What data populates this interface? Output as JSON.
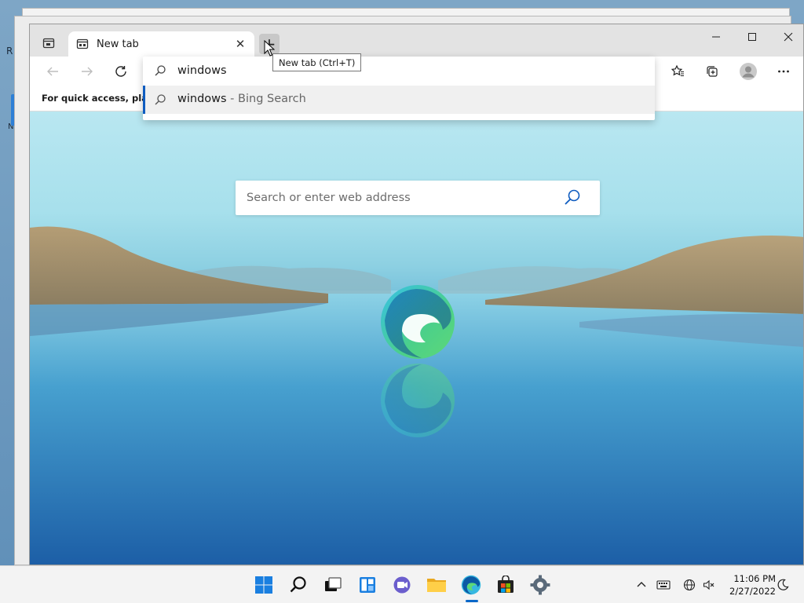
{
  "desktop": {
    "fragment_r": "R",
    "fragment_n": "N"
  },
  "browser": {
    "tab": {
      "label": "New tab"
    },
    "new_tab_tooltip": "New tab (Ctrl+T)",
    "favorites_bar_text": "For quick access, place y",
    "address": {
      "value": "windows"
    },
    "suggestion": {
      "query": "windows",
      "separator": " - ",
      "engine": "Bing Search"
    },
    "page_search": {
      "placeholder": "Search or enter web address"
    }
  },
  "taskbar": {
    "apps": [
      "start-icon",
      "search-icon",
      "task-view-icon",
      "widgets-icon",
      "chat-icon",
      "file-explorer-icon",
      "edge-icon",
      "store-icon",
      "settings-icon"
    ],
    "time": "11:06 PM",
    "date": "2/27/2022"
  },
  "colors": {
    "accent": "#0f5cc0",
    "taskbar_indicator": "#0a67c8"
  }
}
